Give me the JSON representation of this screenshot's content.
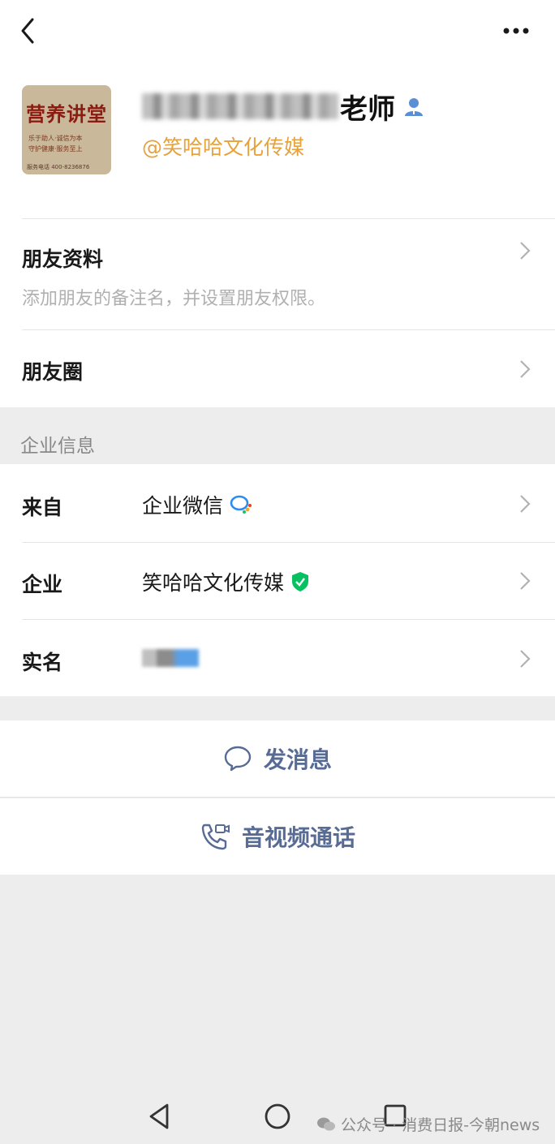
{
  "profile": {
    "name_suffix": "老师",
    "company_tag": "@笑哈哈文化传媒",
    "avatar": {
      "title": "营养讲堂",
      "line1": "乐于助人·诚信为本",
      "line2": "守护健康·服务至上",
      "phone": "服务电话 400-8236876"
    }
  },
  "rows": {
    "friend_profile": {
      "title": "朋友资料",
      "desc": "添加朋友的备注名，并设置朋友权限。"
    },
    "moments": {
      "title": "朋友圈"
    }
  },
  "enterprise": {
    "section_label": "企业信息",
    "from_label": "来自",
    "from_value": "企业微信",
    "company_label": "企业",
    "company_value": "笑哈哈文化传媒",
    "realname_label": "实名"
  },
  "actions": {
    "message": "发消息",
    "call": "音视频通话"
  },
  "watermark": "公众号 · 消费日报-今朝news",
  "colors": {
    "link_blue": "#576b95",
    "company_orange": "#e6a23c",
    "verified_green": "#07c160"
  },
  "icons": [
    "back-arrow-icon",
    "more-icon",
    "contact-icon",
    "enterprise-wechat-icon",
    "verified-shield-icon",
    "chevron-right-icon",
    "chat-bubble-icon",
    "video-call-icon",
    "nav-back-icon",
    "nav-home-icon",
    "nav-recents-icon",
    "wechat-icon"
  ]
}
